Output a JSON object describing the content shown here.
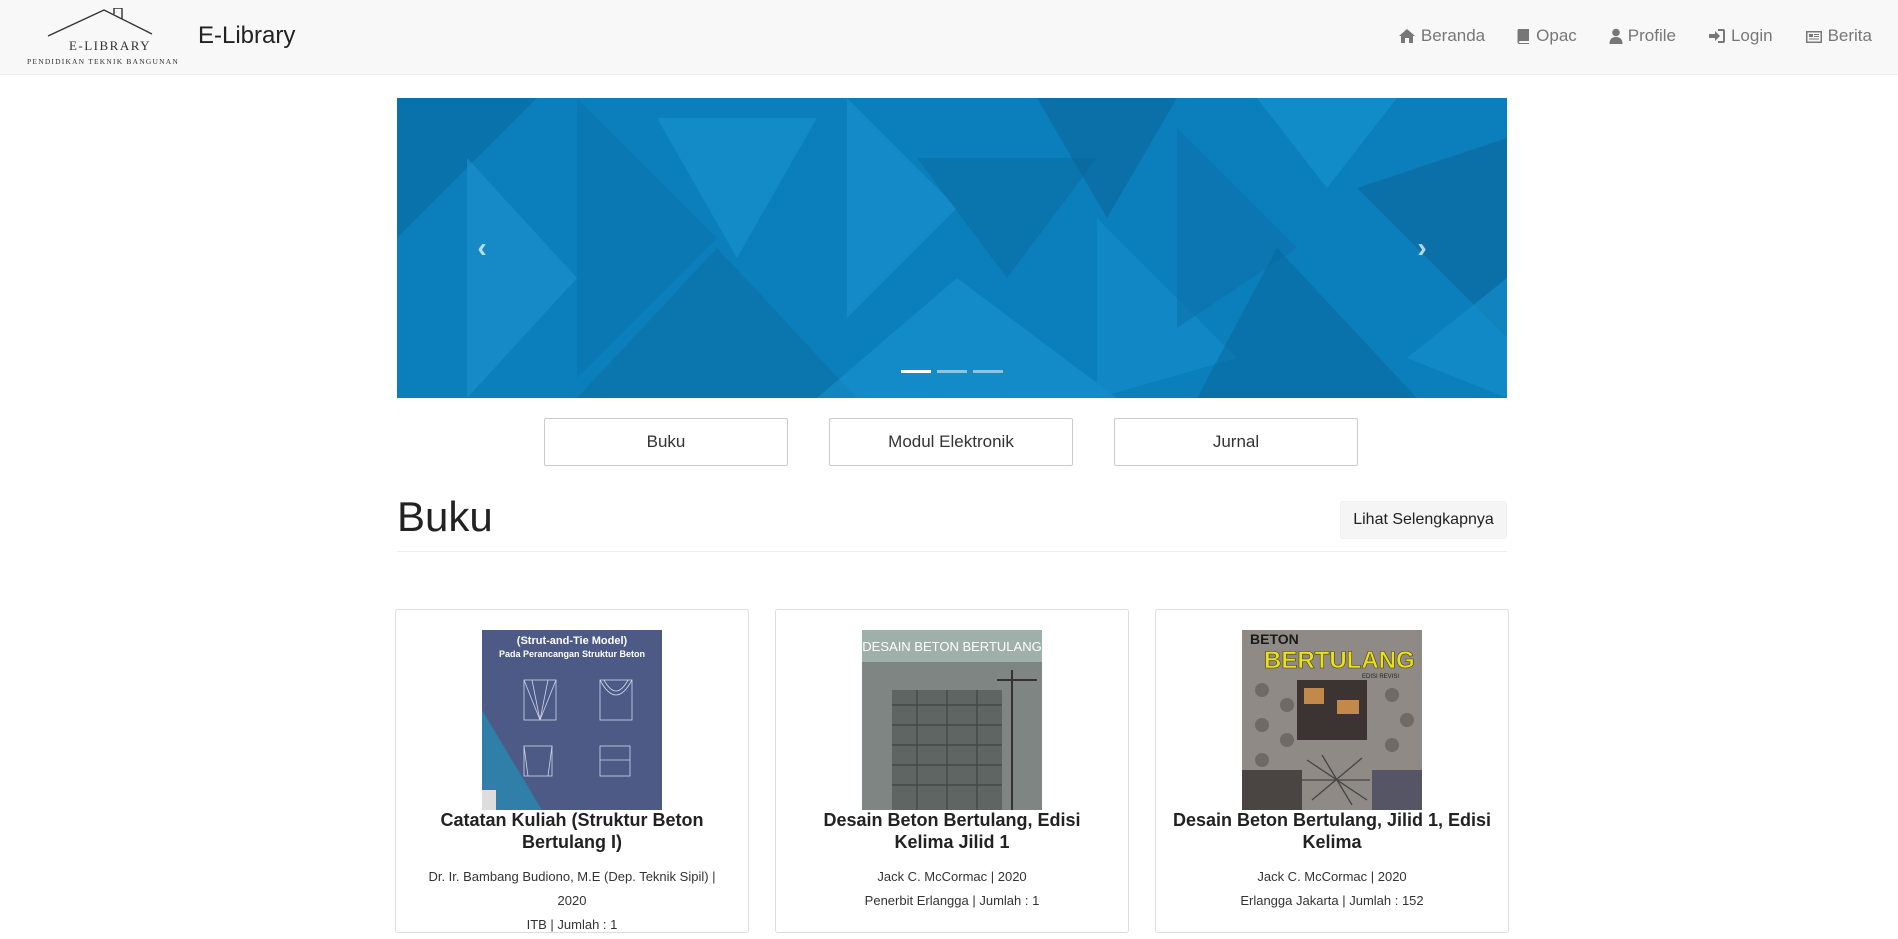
{
  "header": {
    "logo_title": "E-LIBRARY",
    "logo_subtitle": "PENDIDIKAN TEKNIK BANGUNAN",
    "brand": "E-Library",
    "nav": [
      {
        "label": "Beranda",
        "icon": "home-icon"
      },
      {
        "label": "Opac",
        "icon": "book-icon"
      },
      {
        "label": "Profile",
        "icon": "user-icon"
      },
      {
        "label": "Login",
        "icon": "sign-in-icon"
      },
      {
        "label": "Berita",
        "icon": "newspaper-icon"
      }
    ]
  },
  "carousel": {
    "prev_glyph": "‹",
    "next_glyph": "›",
    "slide_count": 3,
    "active_slide": 1,
    "color": "#0b7fbc"
  },
  "categories": [
    "Buku",
    "Modul Elektronik",
    "Jurnal"
  ],
  "section": {
    "title": "Buku",
    "more_label": "Lihat Selengkapnya"
  },
  "books": [
    {
      "cover_title_lines": [
        "(Strut-and-Tie Model)",
        "Pada Perancangan Struktur Beton"
      ],
      "title": "Catatan Kuliah (Struktur Beton Bertulang I)",
      "meta_line1": "Dr. Ir. Bambang Budiono, M.E (Dep. Teknik Sipil) |",
      "meta_line2": "2020",
      "meta_line3": "ITB | Jumlah : 1"
    },
    {
      "cover_title_lines": [
        "DESAIN BETON BERTULANG"
      ],
      "title": "Desain Beton Bertulang, Edisi Kelima Jilid 1",
      "meta_line1": "Jack C. McCormac | 2020",
      "meta_line2": "Penerbit Erlangga | Jumlah : 1"
    },
    {
      "cover_title_lines": [
        "BETON",
        "BERTULANG",
        "EDISI REVISI"
      ],
      "title": "Desain Beton Bertulang, Jilid 1, Edisi Kelima",
      "meta_line1": "Jack C. McCormac | 2020",
      "meta_line2": "Erlangga Jakarta | Jumlah : 152"
    }
  ]
}
